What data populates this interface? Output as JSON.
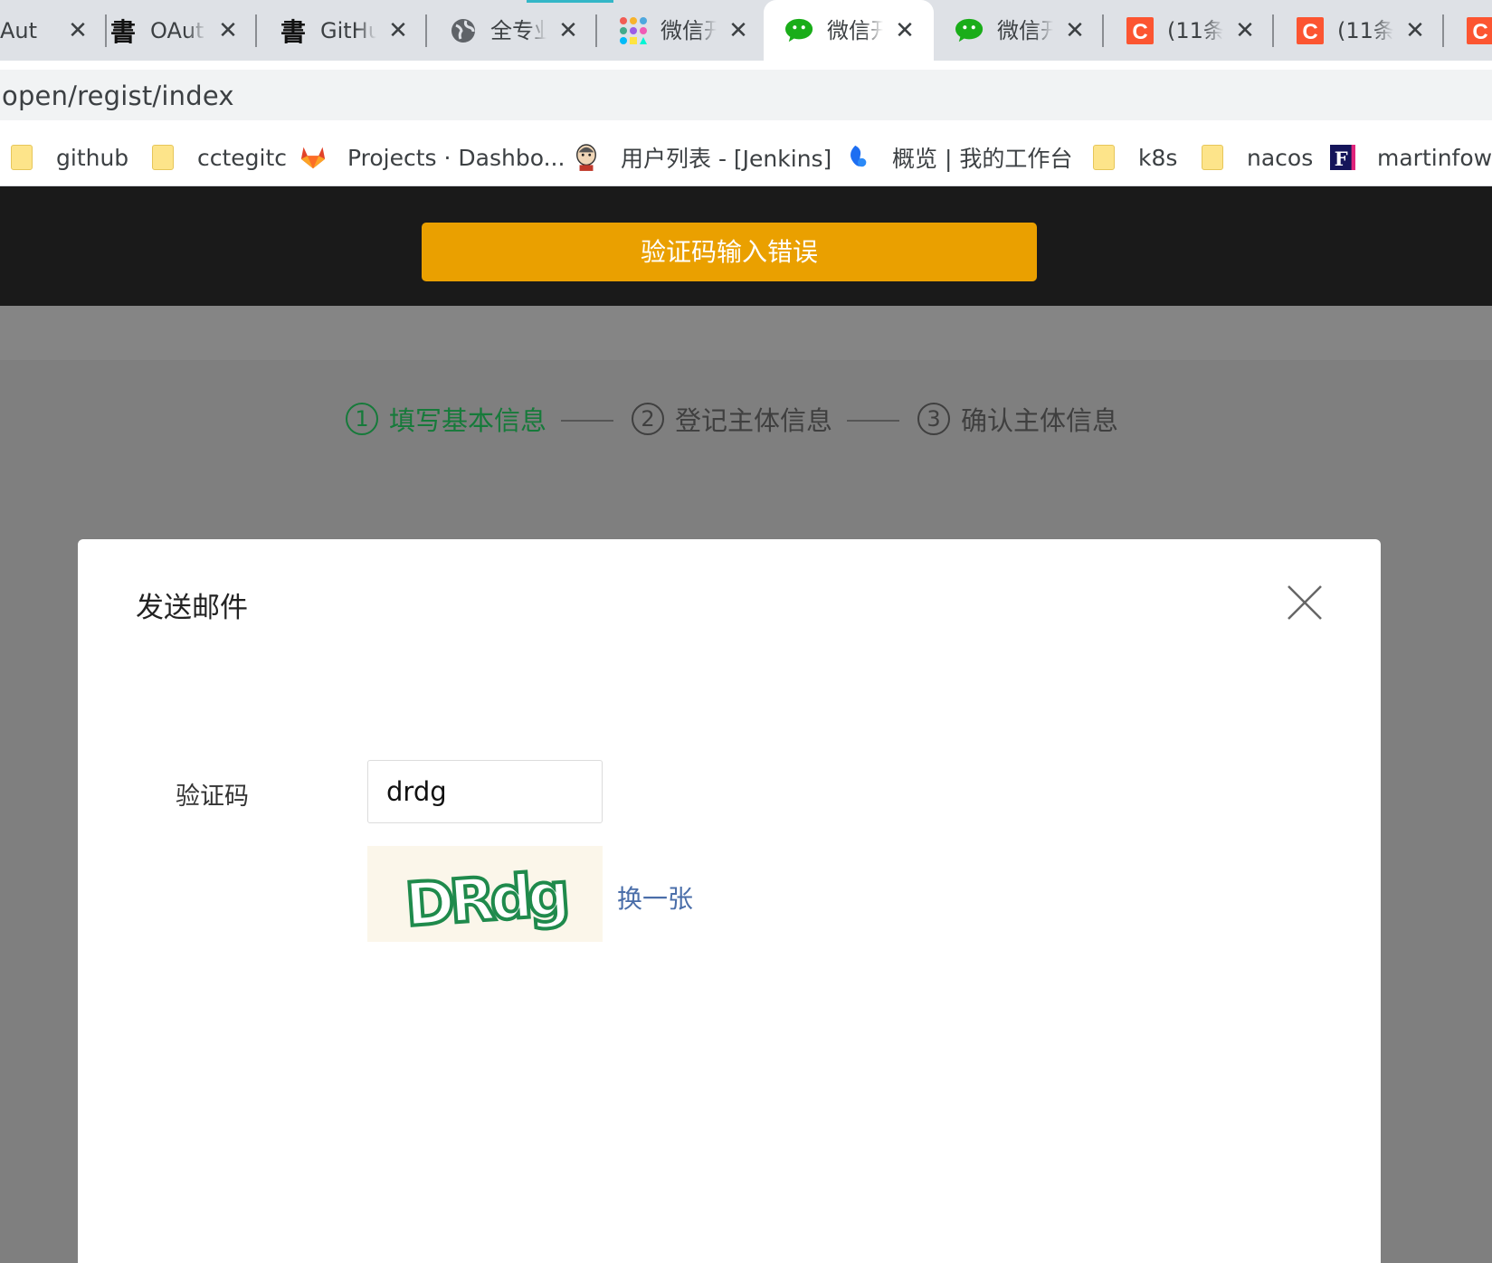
{
  "browser": {
    "tabs": [
      {
        "title": "Aut",
        "icon": "globe-icon",
        "active": false
      },
      {
        "title": "OAut",
        "icon": "shu-calligraphy-icon",
        "active": false
      },
      {
        "title": "GitHu",
        "icon": "shu-calligraphy-icon",
        "active": false
      },
      {
        "title": "全专业",
        "icon": "globe-icon",
        "active": false
      },
      {
        "title": "微信开",
        "icon": "colorful-dots-icon",
        "active": false
      },
      {
        "title": "微信开",
        "icon": "wechat-icon",
        "active": true
      },
      {
        "title": "微信开",
        "icon": "wechat-icon",
        "active": false
      },
      {
        "title": "(11条",
        "icon": "csdn-c-icon",
        "active": false
      },
      {
        "title": "(11条",
        "icon": "csdn-c-icon",
        "active": false
      },
      {
        "title": "",
        "icon": "csdn-c-icon",
        "active": false
      }
    ],
    "close_glyph": "✕",
    "address": "open/regist/index",
    "bookmarks": [
      {
        "label": "github",
        "icon": "folder-icon"
      },
      {
        "label": "cctegitc",
        "icon": "folder-icon"
      },
      {
        "label": "Projects · Dashbo...",
        "icon": "gitlab-fox-icon"
      },
      {
        "label": "用户列表 - [Jenkins]",
        "icon": "jenkins-icon"
      },
      {
        "label": "概览 | 我的工作台",
        "icon": "workbench-icon"
      },
      {
        "label": "k8s",
        "icon": "folder-icon"
      },
      {
        "label": "nacos",
        "icon": "folder-icon"
      },
      {
        "label": "martinfowle",
        "icon": "f-logo-icon"
      }
    ]
  },
  "toast": {
    "message": "验证码输入错误",
    "color": "#eaa000"
  },
  "steps": [
    {
      "num": "1",
      "label": "填写基本信息",
      "active": true
    },
    {
      "num": "2",
      "label": "登记主体信息",
      "active": false
    },
    {
      "num": "3",
      "label": "确认主体信息",
      "active": false
    }
  ],
  "modal": {
    "title": "发送邮件",
    "captcha_label": "验证码",
    "captcha_value": "drdg",
    "captcha_image_text": "DRdg",
    "refresh_label": "换一张"
  },
  "colors": {
    "accent_green": "#167a3a",
    "link_blue": "#4a6ea9",
    "wechat_green": "#1aad19",
    "csdn_red": "#fc5531"
  }
}
